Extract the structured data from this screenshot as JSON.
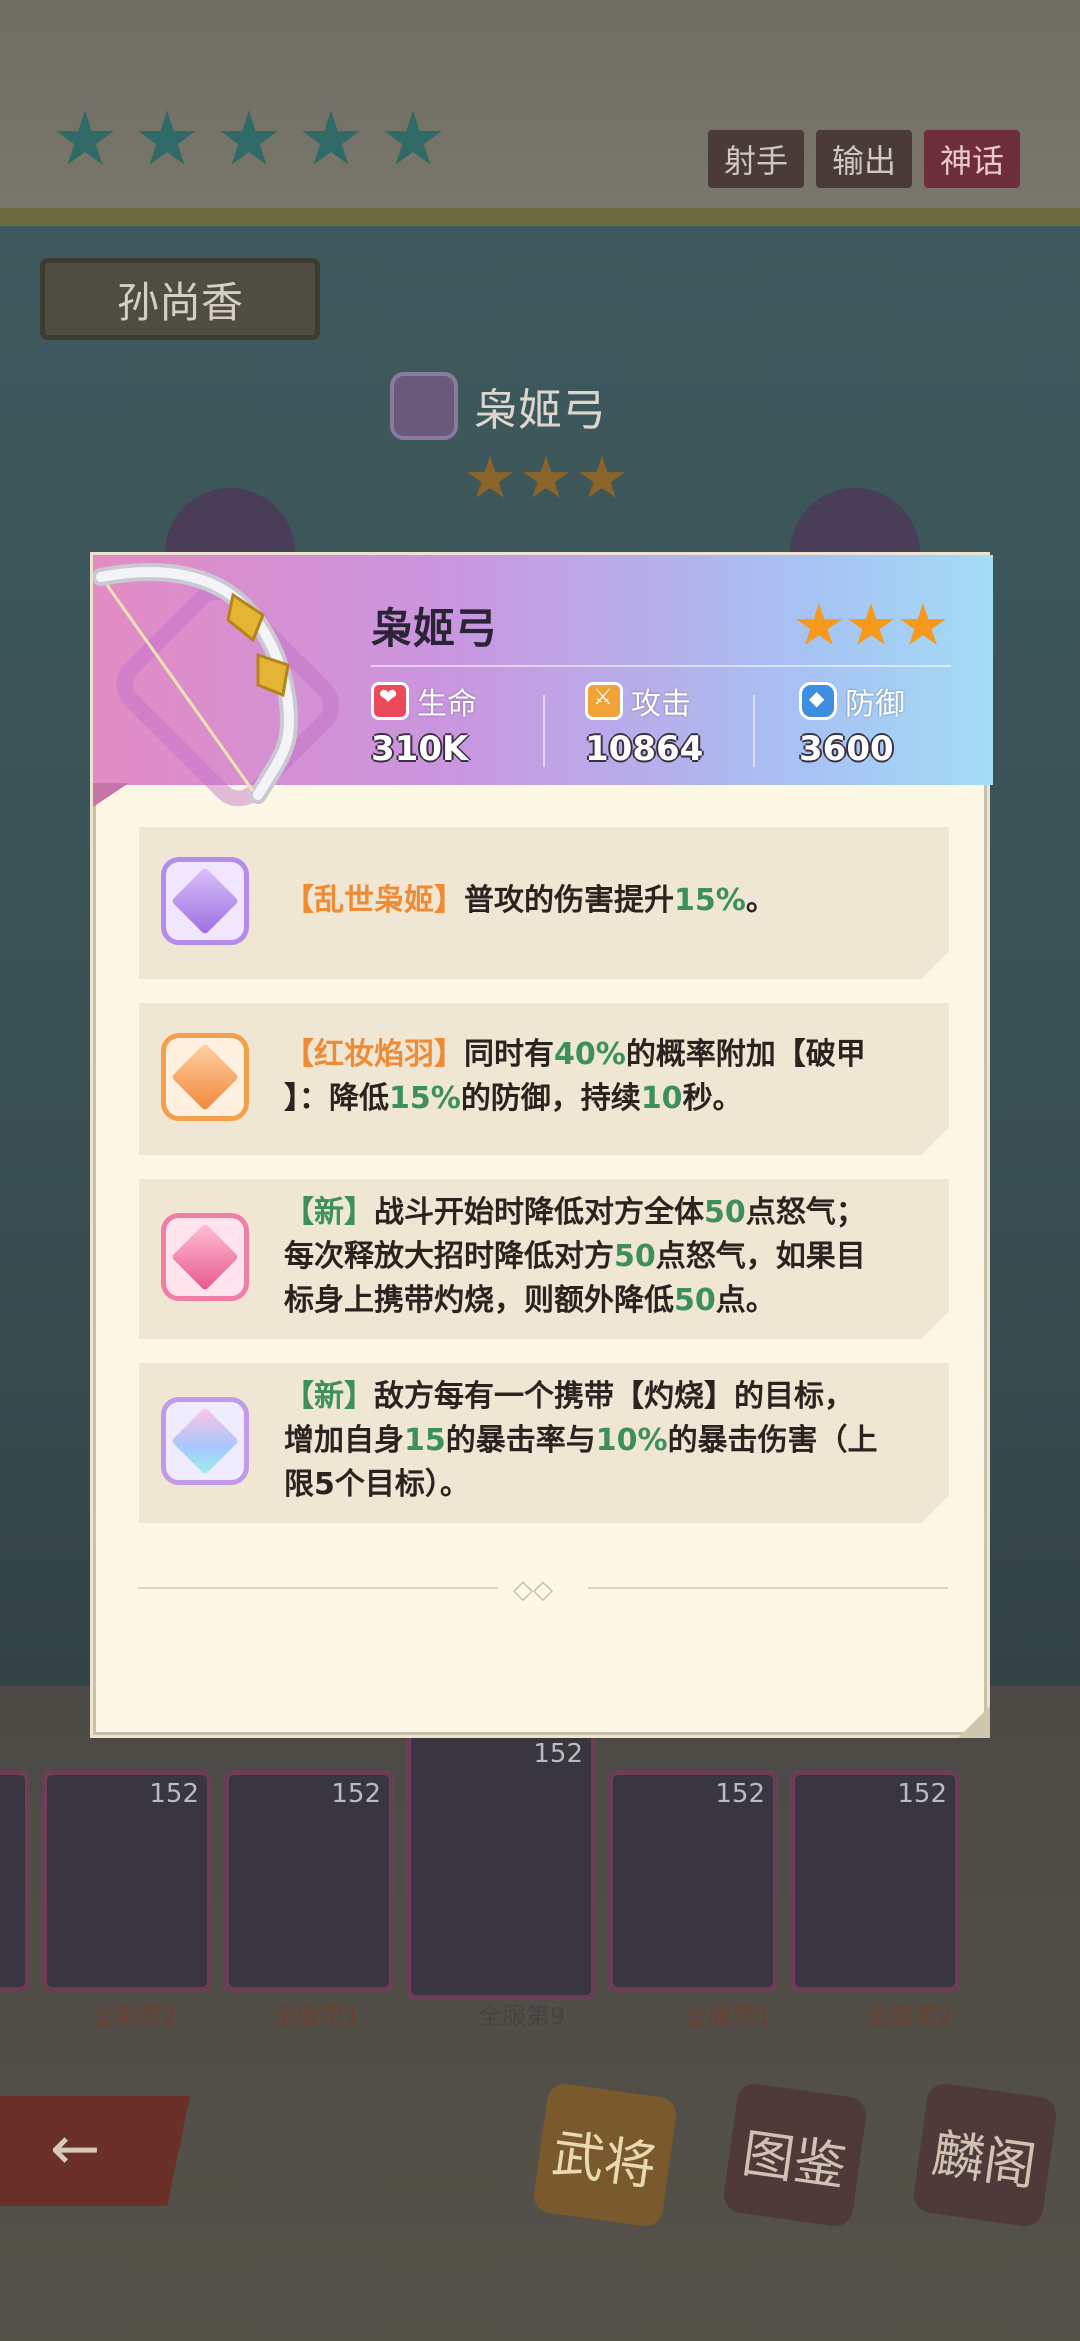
{
  "background": {
    "role_tags": [
      "射手",
      "输出",
      "神话"
    ],
    "hero_name": "孙尚香",
    "weapon_name": "枭姬弓",
    "cards": [
      {
        "level": "152",
        "rank": "全服第2"
      },
      {
        "level": "152",
        "rank": "全服第1"
      },
      {
        "level": "152",
        "rank": "全服第9"
      },
      {
        "level": "152",
        "rank": "全服第1"
      },
      {
        "level": "152",
        "rank": "全服第2"
      }
    ],
    "nav": {
      "generals": "武将",
      "atlas": "图鉴",
      "pavilion": "麟阁"
    }
  },
  "panel": {
    "weapon_name": "枭姬弓",
    "rarity_stars": 3,
    "stats": {
      "hp_label": "生命",
      "hp_value": "310K",
      "atk_label": "攻击",
      "atk_value": "10864",
      "def_label": "防御",
      "def_value": "3600"
    },
    "skills": [
      {
        "name": "【乱世枭姬】",
        "t1": "普攻的伤害提升",
        "v1": "15%",
        "t2": "。"
      },
      {
        "name": "【红妆焰羽】",
        "t1": "同时有",
        "v1": "40%",
        "t2": "的概率附加【破甲",
        "t3": "】：降低",
        "v2": "15%",
        "t4": "的防御，持续",
        "v3": "10",
        "t5": "秒。"
      },
      {
        "name": "【新】",
        "t1": "战斗开始时降低对方全体",
        "v1": "50",
        "t2": "点怒气；",
        "t3": "每次释放大招时降低对方",
        "v2": "50",
        "t4": "点怒气，如果目",
        "t5": "标身上携带灼烧，则额外降低",
        "v3": "50",
        "t6": "点。"
      },
      {
        "name": "【新】",
        "t1": "敌方每有一个携带【灼烧】的目标，",
        "t2": "增加自身",
        "v1": "15",
        "t3": "的暴击率与",
        "v2": "10%",
        "t4": "的暴击伤害（上",
        "t5": "限5个目标）。"
      }
    ]
  }
}
